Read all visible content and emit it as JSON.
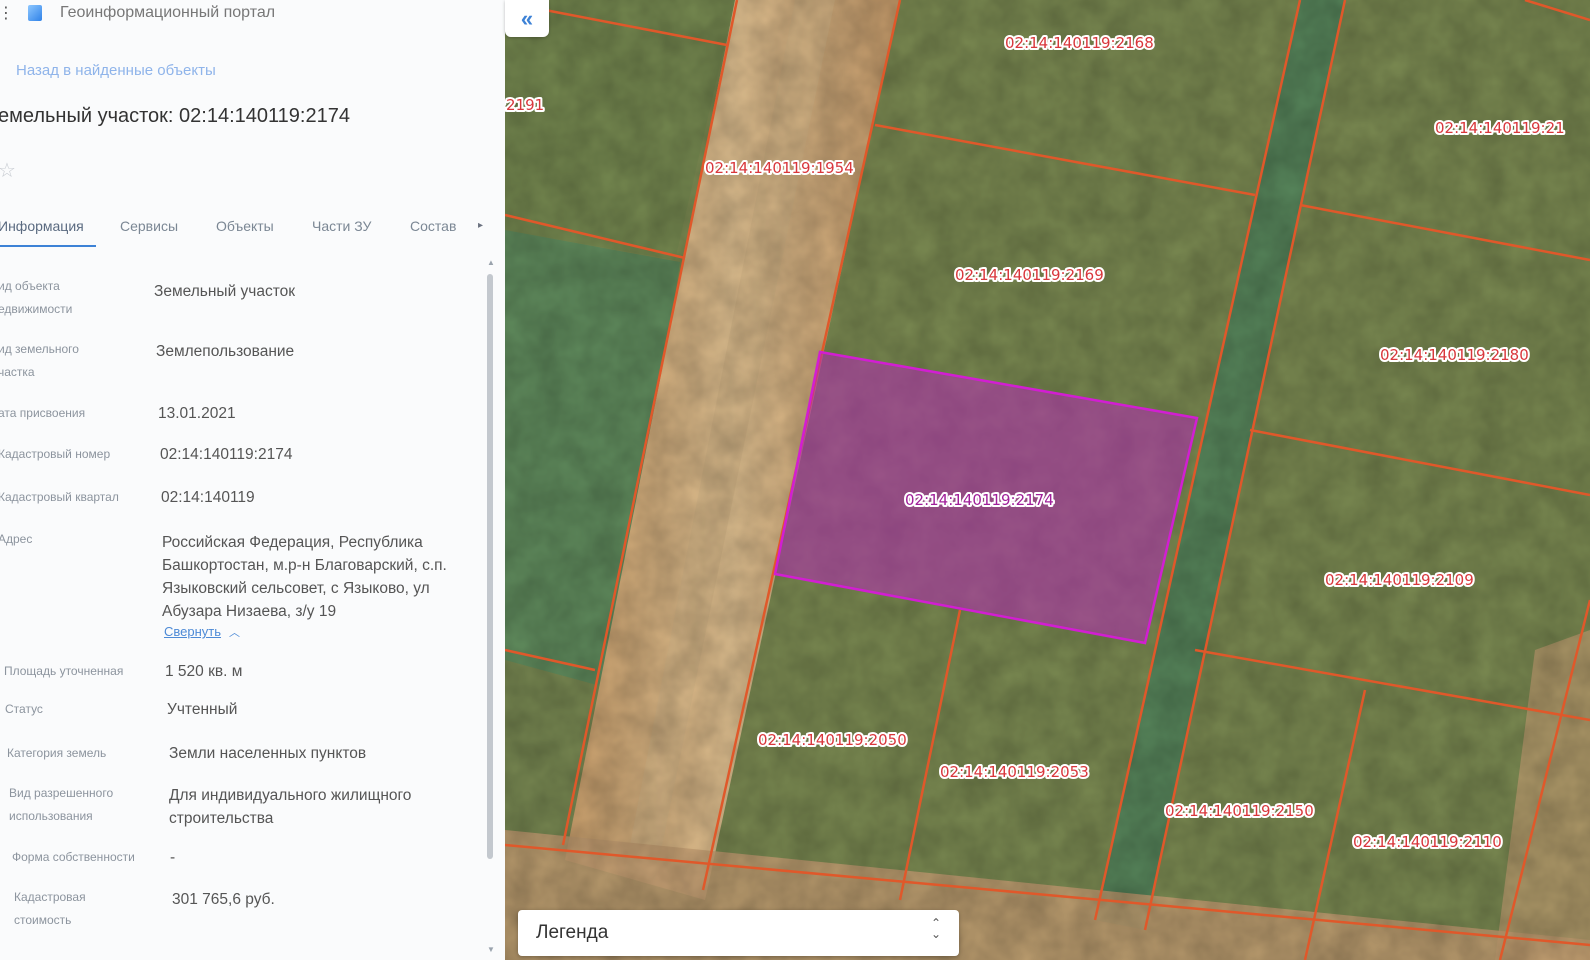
{
  "app": {
    "title": "Геоинформационный портал"
  },
  "nav": {
    "back_label": "Назад в найденные объекты"
  },
  "object": {
    "title": "емельный участок: 02:14:140119:2174"
  },
  "icons": {
    "menu": "menu-icon",
    "logo": "portal-logo-icon",
    "star": "star-icon",
    "collapse": "double-chevron-left-icon",
    "legend_toggle": "chevron-up-down-icon"
  },
  "tabs": [
    {
      "label": "Информация",
      "active": true
    },
    {
      "label": "Сервисы"
    },
    {
      "label": "Объекты"
    },
    {
      "label": "Части ЗУ"
    },
    {
      "label": "Состав"
    }
  ],
  "info_rows": [
    {
      "label": "ид объекта едвижимости",
      "value": "Земельный участок"
    },
    {
      "label": "ид земельного частка",
      "value": "Землепользование"
    },
    {
      "label": "ата присвоения",
      "value": "13.01.2021"
    },
    {
      "label": "Кадастровый номер",
      "value": "02:14:140119:2174"
    },
    {
      "label": "Кадастровый квартал",
      "value": "02:14:140119"
    },
    {
      "label": "Адрес",
      "value": "Российская Федерация, Республика Башкортостан, м.р-н Благоварский, с.п. Языковский сельсовет, с Языково, ул Абузара Низаева, з/у 19"
    },
    {
      "label": "Площадь уточненная",
      "value": "1 520 кв. м"
    },
    {
      "label": "Статус",
      "value": "Учтенный"
    },
    {
      "label": "Категория земель",
      "value": "Земли населенных пунктов"
    },
    {
      "label": "Вид разрешенного использования",
      "value": "Для индивидуального жилищного строительства"
    },
    {
      "label": "Форма собственности",
      "value": "-"
    },
    {
      "label": "Кадастровая стоимость",
      "value": "301 765,6 руб."
    }
  ],
  "address_collapse_label": "Свернуть",
  "map": {
    "legend_label": "Легенда",
    "parcel_labels": [
      "02:14:140119:2168",
      ":2191",
      "02:14:140119:21",
      "02:14:140119:1954",
      "02:14:140119:2169",
      "02:14:140119:2180",
      "02:14:140119:2174",
      "02:14:140119:2109",
      "02:14:140119:2050",
      "02:14:140119:2053",
      "02:14:140119:2150",
      "02:14:140119:2110"
    ],
    "colors": {
      "boundary": "#e0582a",
      "selected": "#c020c0",
      "field": "#7b8a52"
    }
  }
}
